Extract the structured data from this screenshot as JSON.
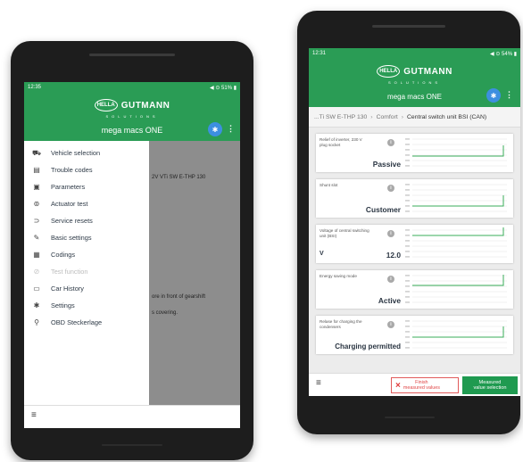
{
  "left_screen": {
    "status": {
      "time": "12:35",
      "right": "◀ ⊙ 51% ▮"
    },
    "logo": {
      "oval": "HELLA",
      "name": "GUTMANN",
      "tagline": "SOLUTIONS"
    },
    "app_title": "mega macs ONE",
    "bluetooth_icon": "bluetooth-icon",
    "menu_icon": "⋮",
    "background_texts": [
      "2V VTi SW E-THP 130",
      "ore in front of gearshift",
      "s covering."
    ],
    "menu_items": [
      {
        "icon": "car-icon",
        "glyph": "🚘",
        "label": "Vehicle selection",
        "enabled": true
      },
      {
        "icon": "trouble-codes-icon",
        "glyph": "▤",
        "label": "Trouble codes",
        "enabled": true
      },
      {
        "icon": "parameters-icon",
        "glyph": "▣",
        "label": "Parameters",
        "enabled": true
      },
      {
        "icon": "actuator-icon",
        "glyph": "⊚",
        "label": "Actuator test",
        "enabled": true
      },
      {
        "icon": "service-reset-icon",
        "glyph": "⊃",
        "label": "Service resets",
        "enabled": true
      },
      {
        "icon": "wrench-icon",
        "glyph": "🔧",
        "label": "Basic settings",
        "enabled": true
      },
      {
        "icon": "codings-icon",
        "glyph": "▦",
        "label": "Codings",
        "enabled": true
      },
      {
        "icon": "test-function-icon",
        "glyph": "⊘",
        "label": "Test function",
        "enabled": false
      },
      {
        "icon": "car-history-icon",
        "glyph": "▭",
        "label": "Car History",
        "enabled": true
      },
      {
        "icon": "gear-icon",
        "glyph": "✱",
        "label": "Settings",
        "enabled": true
      },
      {
        "icon": "search-icon",
        "glyph": "⚲",
        "label": "OBD Steckerlage",
        "enabled": true
      }
    ],
    "bottom_menu_icon": "≡"
  },
  "right_screen": {
    "status": {
      "time": "12:31",
      "right": "◀ ⊙ 54% ▮"
    },
    "logo": {
      "oval": "HELLA",
      "name": "GUTMANN",
      "tagline": "SOLUTIONS"
    },
    "app_title": "mega macs ONE",
    "bluetooth_icon": "bluetooth-icon",
    "menu_icon": "⋮",
    "breadcrumb": {
      "vehicle": "...Ti SW E-THP 130",
      "category": "Comfort",
      "current": "Central switch unit BSI (CAN)",
      "separator": "›"
    },
    "parameters": [
      {
        "name": "Relief of inverter, 230 V plug socket",
        "value": "Passive",
        "unit": ""
      },
      {
        "name": "Shunt slot",
        "value": "Customer",
        "unit": ""
      },
      {
        "name": "Voltage of central switching unit (BSI)",
        "value": "12.0",
        "unit": "V"
      },
      {
        "name": "Energy saving mode",
        "value": "Active",
        "unit": ""
      },
      {
        "name": "Relase for charging the condensers",
        "value": "Charging permitted",
        "unit": ""
      }
    ],
    "info_glyph": "i",
    "bottom_menu_icon": "≡",
    "finish_button": {
      "line1": "Finish",
      "line2": "measured values",
      "icon": "×"
    },
    "measured_button": {
      "line1": "Measured",
      "line2": "value selection"
    },
    "colors": {
      "header_green": "#2a9c55",
      "measured_green": "#1f9a50",
      "finish_red": "#e03a3a",
      "bluetooth_blue": "#3d8fe0",
      "chart_line": "#3aae5a"
    }
  }
}
